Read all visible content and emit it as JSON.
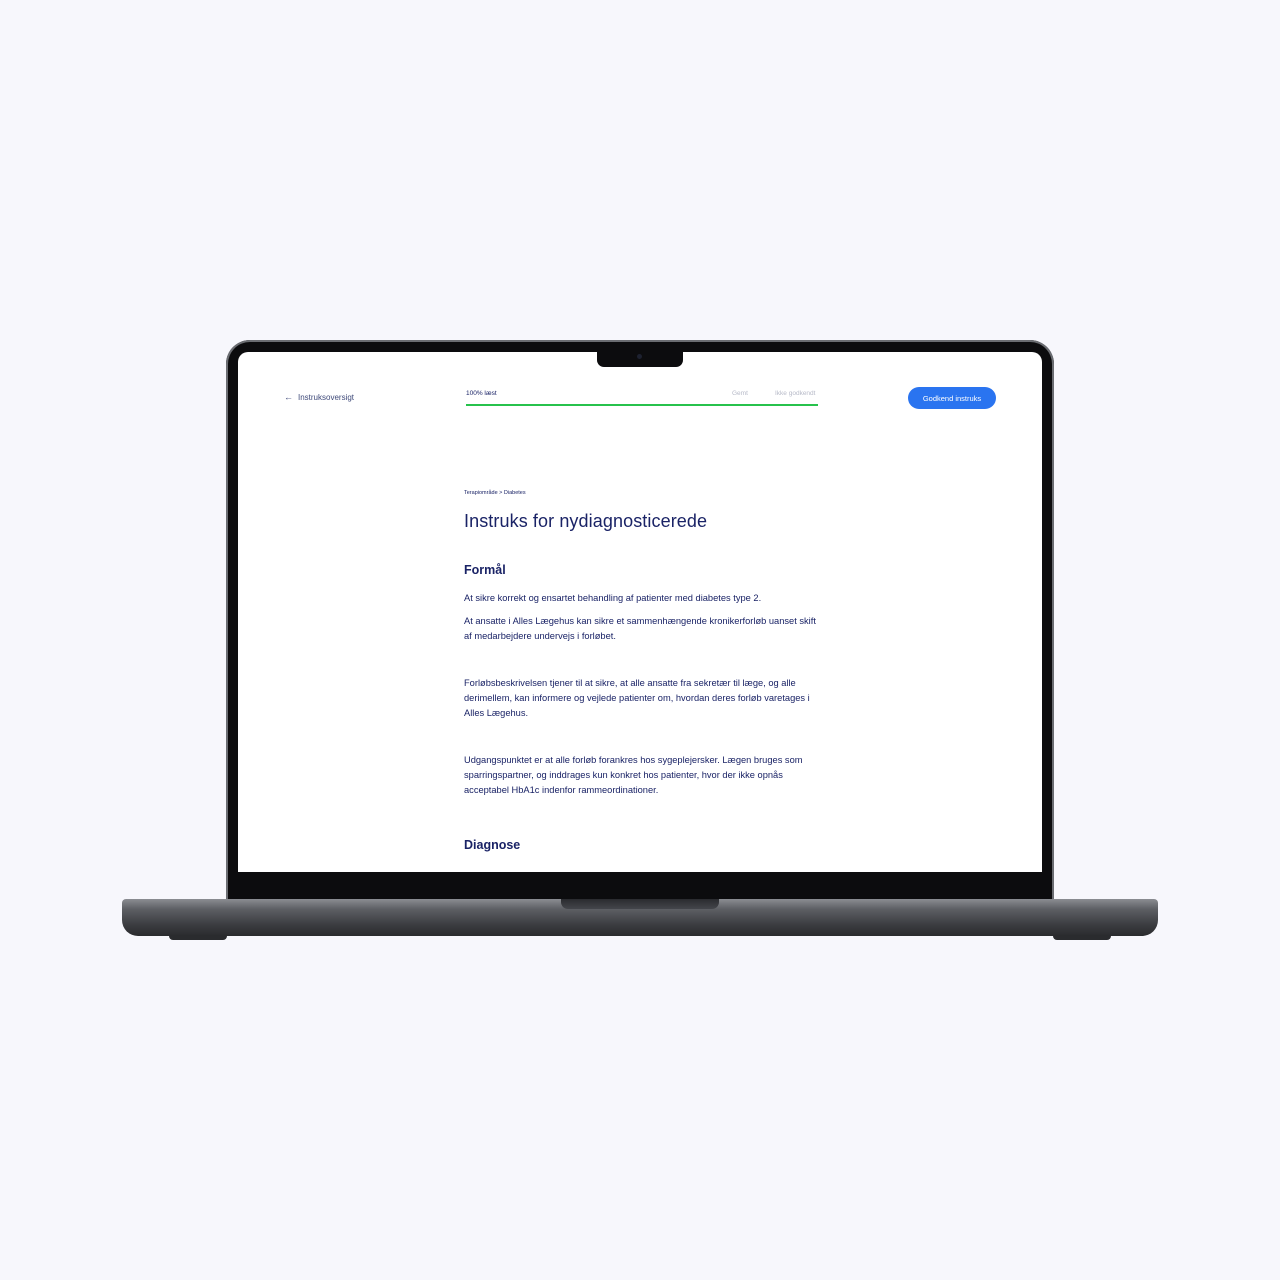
{
  "header": {
    "back_link_label": "Instruksoversigt",
    "progress_label": "100% læst",
    "progress_fraction": 1.0,
    "saved_label": "Gemt",
    "status_label": "Ikke godkendt",
    "approve_button_label": "Godkend instruks"
  },
  "article": {
    "breadcrumb": "Terapiområde > Diabetes",
    "title": "Instruks for nydiagnosticerede",
    "sections": [
      {
        "heading": "Formål",
        "paragraphs": [
          "At sikre korrekt og ensartet behandling af patienter med diabetes type 2.",
          "At ansatte i Alles Lægehus kan sikre et sammenhængende kronikerforløb uanset skift af medarbejdere undervejs i forløbet.",
          "Forløbsbeskrivelsen tjener til at sikre, at alle ansatte fra sekretær til læge, og alle derimellem, kan informere og vejlede patienter om, hvordan deres forløb varetages i Alles Lægehus.",
          "Udgangspunktet er at alle forløb forankres hos sygeplejersker. Lægen bruges som sparringspartner, og inddrages kun konkret hos patienter, hvor der ikke opnås acceptabel HbA1c indenfor rammeordinationer."
        ]
      },
      {
        "heading": "Diagnose",
        "paragraphs": []
      }
    ]
  },
  "colors": {
    "page_background": "#f7f7fc",
    "text_primary": "#1a2366",
    "accent_button": "#2a74f0",
    "progress_fill": "#27c24c",
    "muted_text": "#b7bac8"
  }
}
